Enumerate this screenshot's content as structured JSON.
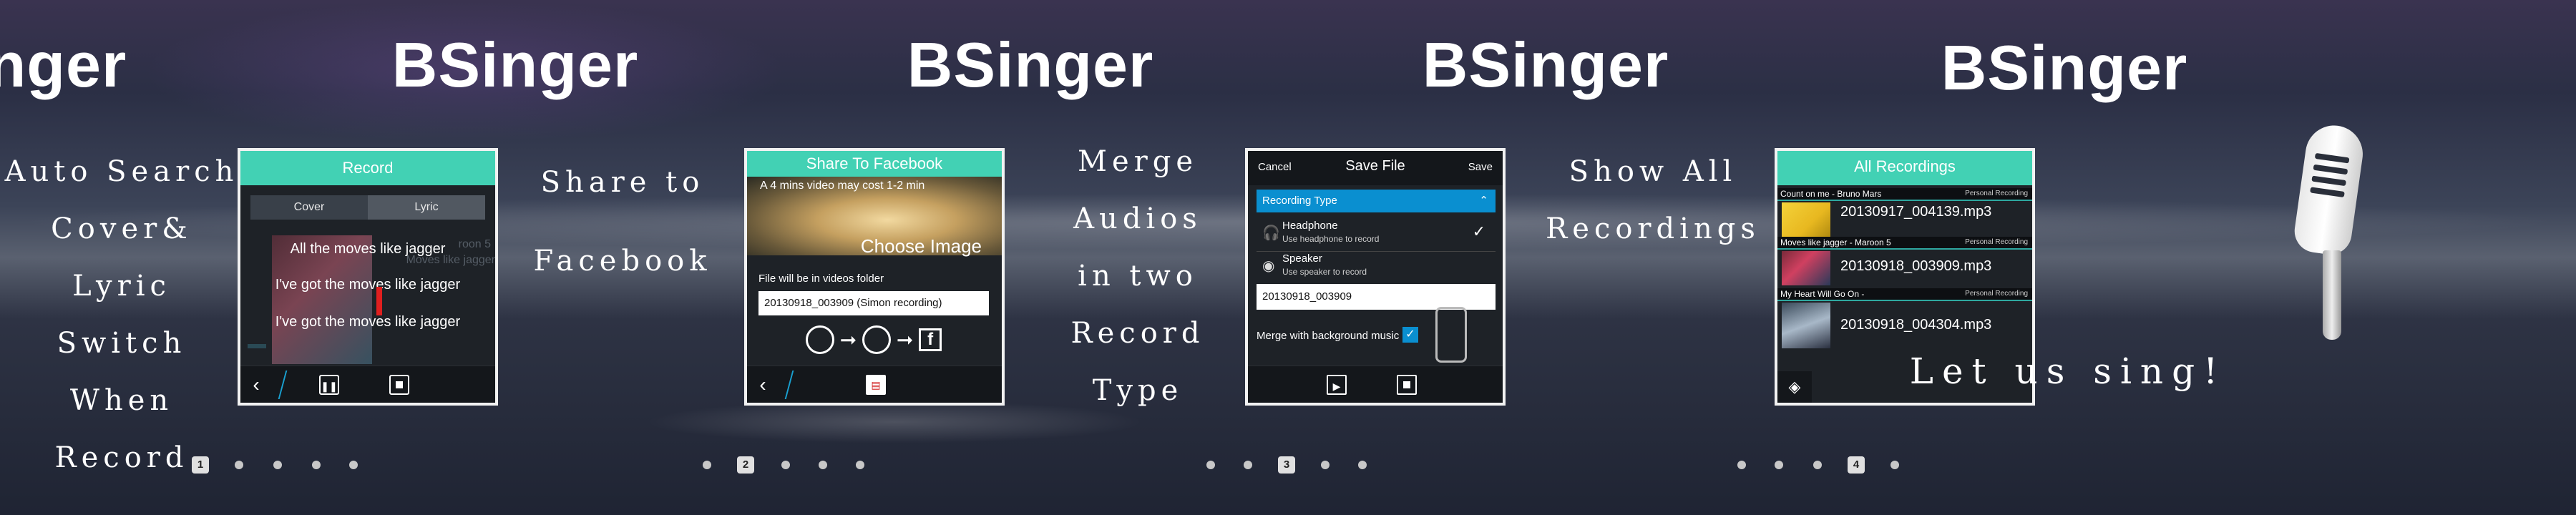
{
  "app_title": "BSinger",
  "panels": [
    {
      "caption_lines": [
        "Auto Search",
        "Cover& Lyric",
        "Switch",
        "When Record"
      ],
      "screen": {
        "header": "Record",
        "tabs": [
          "Cover",
          "Lyric"
        ],
        "lyrics": [
          "All the moves like jagger",
          "I've got the moves like jagger",
          "I've got the moves like jagger"
        ],
        "faint_text": [
          "roon 5",
          "Moves like jagger"
        ]
      },
      "page": "1"
    },
    {
      "caption_lines": [
        "Share to",
        "Facebook"
      ],
      "screen": {
        "header": "Share To Facebook",
        "image_caption": "A 4 mins video may cost 1-2 min",
        "choose_image": "Choose Image",
        "note": "File will be in videos folder",
        "filename": "20130918_003909 (Simon recording)"
      },
      "page": "2"
    },
    {
      "caption_lines": [
        "Merge",
        "Audios",
        "in two",
        "Record",
        "Type"
      ],
      "screen": {
        "cancel": "Cancel",
        "title": "Save File",
        "save": "Save",
        "recording_type": "Recording Type",
        "options": [
          {
            "title": "Headphone",
            "subtitle": "Use headphone to record",
            "checked": true
          },
          {
            "title": "Speaker",
            "subtitle": "Use speaker to record",
            "checked": false
          }
        ],
        "filename": "20130918_003909",
        "merge_label": "Merge with background music"
      },
      "page": "3"
    },
    {
      "caption_lines": [
        "Show All",
        "Recordings"
      ],
      "screen": {
        "header": "All Recordings",
        "recordings": [
          {
            "song": "Count on me - Bruno Mars",
            "tag": "Personal Recording",
            "file": "20130917_004139.mp3"
          },
          {
            "song": "Moves like jagger - Maroon 5",
            "tag": "Personal Recording",
            "file": "20130918_003909.mp3"
          },
          {
            "song": "My Heart Will Go On -",
            "tag": "Personal Recording",
            "file": "20130918_004304.mp3"
          }
        ]
      },
      "page": "4"
    },
    {
      "slogan": "Let us sing!"
    }
  ],
  "icons": {
    "back": "chevron-left-icon",
    "pause": "pause-icon",
    "stop": "stop-icon",
    "play": "play-icon",
    "share": "share-icon",
    "layers": "layers-icon",
    "checkmark": "check-icon",
    "headphone": "headphone-icon",
    "speaker": "speaker-icon",
    "microphone": "microphone-icon"
  },
  "colors": {
    "accent": "#42d1b4",
    "blue": "#0a8fd0",
    "record_red": "#e01f1f"
  }
}
